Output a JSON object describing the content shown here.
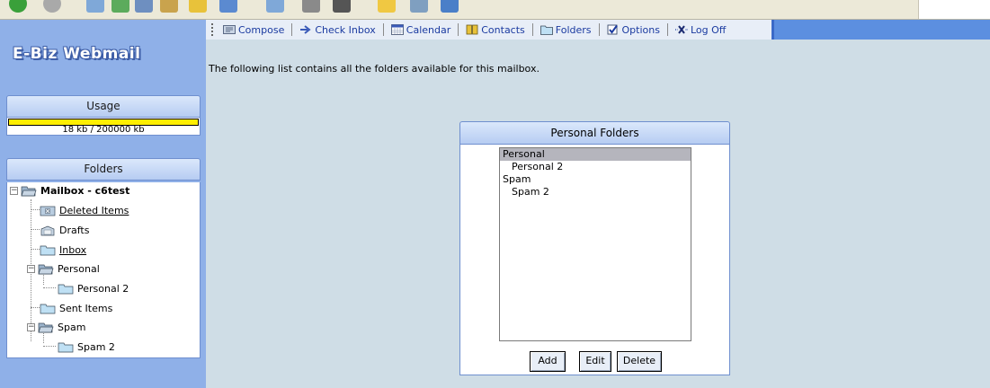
{
  "app": {
    "logo": "E-Biz Webmail"
  },
  "nav": {
    "items": [
      {
        "label": "Compose",
        "icon": "compose-icon"
      },
      {
        "label": "Check Inbox",
        "icon": "arrow-right-icon"
      },
      {
        "label": "Calendar",
        "icon": "calendar-icon"
      },
      {
        "label": "Contacts",
        "icon": "book-icon"
      },
      {
        "label": "Folders",
        "icon": "folder-icon"
      },
      {
        "label": "Options",
        "icon": "checkbox-icon"
      },
      {
        "label": "Log Off",
        "icon": "x-icon"
      }
    ]
  },
  "usage": {
    "title": "Usage",
    "text": "18 kb / 200000 kb",
    "fraction": 9e-05,
    "bar_color": "#ffee00"
  },
  "folders": {
    "title": "Folders",
    "tree": [
      {
        "label": "Mailbox - c6test",
        "bold": true
      },
      {
        "label": "Deleted Items",
        "link": true
      },
      {
        "label": "Drafts"
      },
      {
        "label": "Inbox",
        "link": true
      },
      {
        "label": "Personal"
      },
      {
        "label": "Personal 2"
      },
      {
        "label": "Sent Items"
      },
      {
        "label": "Spam"
      },
      {
        "label": "Spam 2"
      }
    ]
  },
  "main": {
    "intro": "The following list contains all the folders available for this mailbox.",
    "personal_folders": {
      "title": "Personal Folders",
      "options": [
        {
          "label": "Personal",
          "selected": true
        },
        {
          "label": "Personal 2"
        },
        {
          "label": "Spam"
        },
        {
          "label": "Spam 2"
        }
      ],
      "buttons": {
        "add": "Add",
        "edit": "Edit",
        "delete": "Delete"
      }
    }
  },
  "colors": {
    "sidebar": "#8fb0e8",
    "navbar": "#5c8fe0",
    "content_bg": "#cfdde6",
    "selection": "#b5b5bd"
  }
}
